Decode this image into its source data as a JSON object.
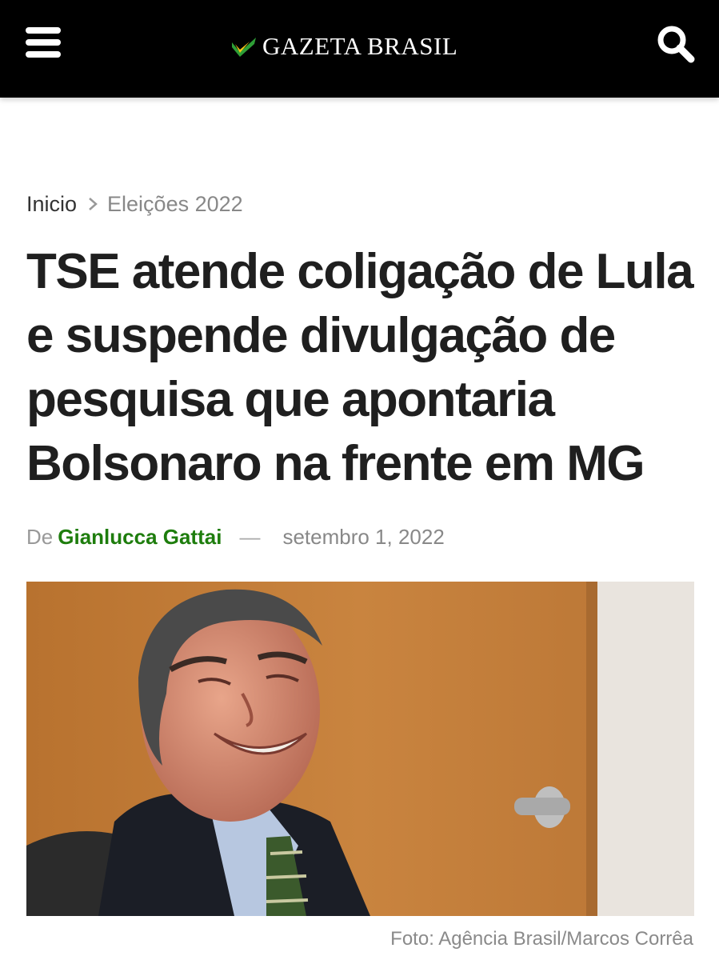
{
  "header": {
    "site_name": "GAZETA BRASIL",
    "menu_icon": "menu-icon",
    "search_icon": "search-icon",
    "colors": {
      "background": "#000000",
      "logo_green": "#2e9e36",
      "logo_yellow": "#f5c518"
    }
  },
  "breadcrumb": {
    "home": "Inicio",
    "current": "Eleições 2022"
  },
  "article": {
    "title": "TSE atende coligação de Lula e suspende divulgação de pesquisa que apontaria Bolsonaro na frente em MG",
    "byline_prefix": "De",
    "author": "Gianlucca Gattai",
    "separator": "—",
    "date": "setembro 1, 2022",
    "photo_credit": "Foto: Agência Brasil/Marcos Corrêa",
    "colors": {
      "author": "#1e7d0d"
    }
  }
}
